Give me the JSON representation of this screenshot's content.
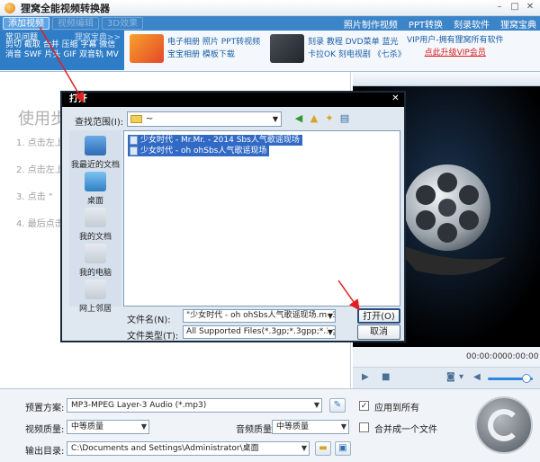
{
  "app": {
    "title": "狸窝全能视频转换器"
  },
  "toolbar": {
    "add_video": "添加视频",
    "tab2": "视频编辑",
    "tab3": "3D效果",
    "right_links": [
      "照片制作视频",
      "PPT转换",
      "刻录软件",
      "狸窝宝典"
    ]
  },
  "banner": {
    "faq_title": "常见问题",
    "faq_more": "狸窝宝典>>",
    "faq_links": [
      "剪切 截取 合并 压缩 字幕 微信",
      "消音 SWF 片头 GIF 双音轨 MV"
    ],
    "promo1": {
      "line1": "电子相册 照片 PPT转视频",
      "line2": "宝宝相册 模板下载"
    },
    "promo2": {
      "line1": "刻录 教程 DVD菜单 蓝光",
      "line2": "卡拉OK 刻电视剧 《七杀》"
    },
    "vip": {
      "line1": "VIP用户-拥有狸窝所有软件",
      "line2": "点此升级VIP会员"
    }
  },
  "main": {
    "usage_title": "使用步",
    "steps": [
      "1. 点击左上",
      "2. 点击左上",
      "3. 点击 \"",
      "4. 最后点击"
    ]
  },
  "preview": {
    "time_start": "00:00:00",
    "time_end": "00:00:00"
  },
  "dialog": {
    "title": "打开",
    "lookin_label": "查找范围(I):",
    "lookin_value": "~",
    "places": [
      "我最近的文档",
      "桌面",
      "我的文档",
      "我的电脑",
      "网上邻居"
    ],
    "files": [
      "少女时代 - Mr.Mr. - 2014 Sbs人气歌谣现场",
      "少女时代 - oh ohSbs人气歌谣现场"
    ],
    "filename_label": "文件名(N):",
    "filename_value": "\"少女时代 - oh ohSbs人气歌谣现场.mp3\"",
    "filetype_label": "文件类型(T):",
    "filetype_value": "All Supported Files(*.3gp;*.3gpp;*.3g",
    "open_button": "打开(O)",
    "cancel_button": "取消"
  },
  "settings": {
    "preset_label": "预置方案:",
    "preset_value": "MP3-MPEG Layer-3 Audio (*.mp3)",
    "apply_all_label": "应用到所有",
    "apply_all_checked": true,
    "video_quality_label": "视频质量:",
    "video_quality_value": "中等质量",
    "audio_quality_label": "音频质量:",
    "audio_quality_value": "中等质量",
    "merge_label": "合并成一个文件",
    "merge_checked": false,
    "output_label": "输出目录:",
    "output_value": "C:\\Documents and Settings\\Administrator\\桌面"
  },
  "colors": {
    "toolbar_bg": "#3b84c8",
    "arrow": "#e02020",
    "selection": "#316ac5"
  }
}
